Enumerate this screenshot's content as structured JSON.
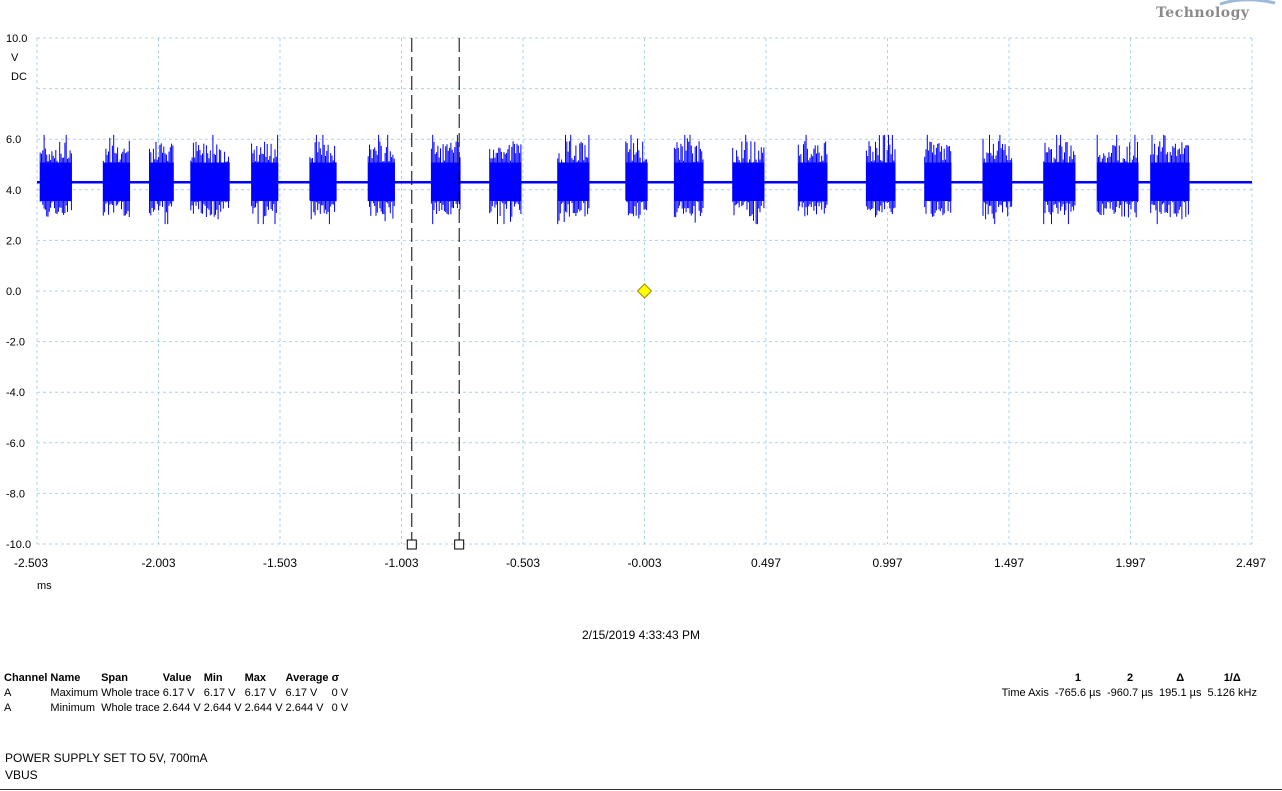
{
  "logo_text": "Technology",
  "timestamp": "2/15/2019 4:33:43 PM",
  "notes": [
    "POWER SUPPLY SET TO 5V, 700mA",
    "VBUS"
  ],
  "colors": {
    "trace": "#0000ff",
    "grid": "#a8d4f0",
    "trigger_marker": "#ffff00",
    "cursor": "#000000"
  },
  "measurements": {
    "headers": [
      "Channel",
      "Name",
      "Span",
      "Value",
      "Min",
      "Max",
      "Average",
      "σ"
    ],
    "rows": [
      [
        "A",
        "Maximum",
        "Whole trace",
        "6.17 V",
        "6.17 V",
        "6.17 V",
        "6.17 V",
        "0 V"
      ],
      [
        "A",
        "Minimum",
        "Whole trace",
        "2.644 V",
        "2.644 V",
        "2.644 V",
        "2.644 V",
        "0 V"
      ]
    ]
  },
  "cursor_table": {
    "headers": [
      "",
      "1",
      "2",
      "Δ",
      "1/Δ"
    ],
    "row": [
      "Time Axis",
      "-765.6 µs",
      "-960.7 µs",
      "195.1 µs",
      "5.126 kHz"
    ]
  },
  "chart_data": {
    "type": "line",
    "title": "",
    "xlabel": "ms",
    "ylabel": "V DC",
    "y_unit_lines": [
      "V",
      "DC"
    ],
    "xlim": [
      -2.503,
      2.497
    ],
    "ylim": [
      -10.0,
      10.0
    ],
    "x_ticks": [
      "-2.503",
      "-2.003",
      "-1.503",
      "-1.003",
      "-0.503",
      "-0.003",
      "0.497",
      "0.997",
      "1.497",
      "1.997",
      "2.497"
    ],
    "x_tick_values": [
      -2.503,
      -2.003,
      -1.503,
      -1.003,
      -0.503,
      -0.003,
      0.497,
      0.997,
      1.497,
      1.997,
      2.497
    ],
    "y_ticks": [
      "10.0",
      "6.0",
      "4.0",
      "2.0",
      "0.0",
      "-2.0",
      "-4.0",
      "-6.0",
      "-8.0",
      "-10.0"
    ],
    "y_tick_values": [
      10,
      6,
      4,
      2,
      0,
      -2,
      -4,
      -6,
      -8,
      -10
    ],
    "grid": true,
    "series": [
      {
        "baseline": 4.3,
        "burst_max": 6.17,
        "burst_min": 2.644,
        "bursts": [
          [
            -2.49,
            -2.36
          ],
          [
            -2.23,
            -2.12
          ],
          [
            -2.04,
            -1.94
          ],
          [
            -1.87,
            -1.71
          ],
          [
            -1.62,
            -1.51
          ],
          [
            -1.38,
            -1.27
          ],
          [
            -1.14,
            -1.03
          ],
          [
            -0.88,
            -0.76
          ],
          [
            -0.64,
            -0.51
          ],
          [
            -0.36,
            -0.23
          ],
          [
            -0.08,
            0.01
          ],
          [
            0.12,
            0.24
          ],
          [
            0.36,
            0.49
          ],
          [
            0.63,
            0.75
          ],
          [
            0.91,
            1.03
          ],
          [
            1.15,
            1.26
          ],
          [
            1.39,
            1.51
          ],
          [
            1.64,
            1.77
          ],
          [
            1.86,
            2.03
          ],
          [
            2.08,
            2.24
          ]
        ]
      }
    ],
    "cursors_x": [
      -0.9607,
      -0.7656
    ],
    "trigger_marker": {
      "x": -0.003,
      "y": 0.0
    }
  }
}
